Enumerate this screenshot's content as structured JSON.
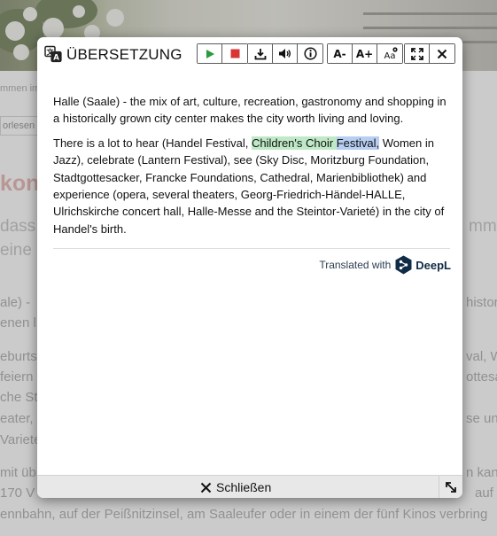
{
  "background": {
    "breadcrumb": "mmen im",
    "read_button": "orlesen",
    "heading": "kon",
    "lead_lines": [
      "dass",
      "eine",
      "mmen"
    ],
    "para_lines": [
      "ale) -",
      "enen l",
      "eburtss",
      "feiern",
      "che St",
      "eater,",
      "Variete",
      "mit üb",
      "170 V",
      "ennbahn, auf der Peißnitzinsel, am Saaleufer oder in einem der fünf Kinos verbring"
    ],
    "right_fragments": [
      "histori",
      "val, W",
      "ottesa",
      "se und",
      "n kann",
      "auf"
    ]
  },
  "dialog": {
    "title": "ÜBERSETZUNG",
    "toolbar": {
      "play": "play-icon",
      "stop": "stop-icon",
      "download": "download-icon",
      "volume": "volume-icon",
      "info": "info-icon",
      "font_decrease": "A-",
      "font_increase": "A+",
      "font_settings": "Aa",
      "fullscreen": "expand-icon",
      "close": "close-icon"
    },
    "paragraphs": {
      "p1": "Halle (Saale) - the mix of art, culture, recreation, gastronomy and shopping in a historically grown city center makes the city worth living and loving.",
      "p2_before": "There is a lot to hear (Handel Festival, ",
      "p2_hl_green": "Children's Choir ",
      "p2_hl_blue": "Festival,",
      "p2_after": " Women in Jazz), celebrate (Lantern Festival), see (Sky Disc, Moritzburg Foundation, Stadtgottesacker, Francke Foundations, Cathedral, Marienbibliothek) and experience (opera, several theaters, Georg-Friedrich-Händel-HALLE, Ulrichskirche concert hall, Halle-Messe and the Steintor-Varieté) in the city of Handel's birth."
    },
    "attribution": {
      "text": "Translated with",
      "brand": "DeepL"
    },
    "footer": {
      "close_label": "Schließen"
    }
  },
  "colors": {
    "highlight_green": "#bfe9c6",
    "highlight_blue": "#b7cdf1",
    "play_green": "#2a9a3a",
    "stop_red": "#d93434",
    "deepl_navy": "#0f2b46"
  }
}
